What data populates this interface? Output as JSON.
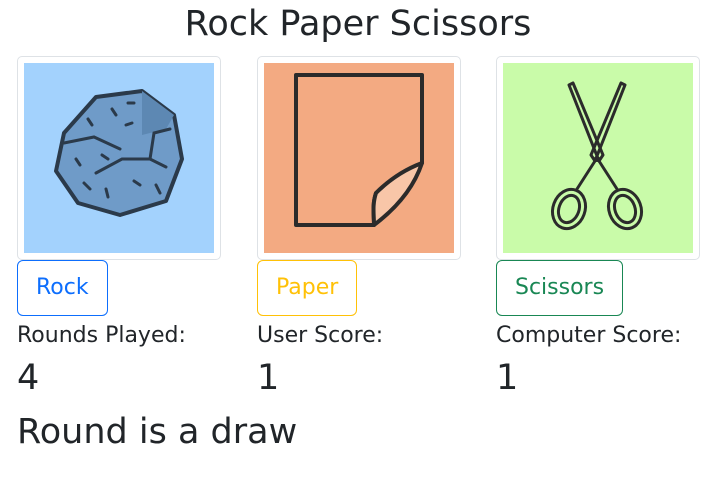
{
  "title": "Rock Paper Scissors",
  "choices": [
    {
      "key": "rock",
      "label": "Rock",
      "image_bg": "#a3d2fd",
      "button_color": "#0d6efd"
    },
    {
      "key": "paper",
      "label": "Paper",
      "image_bg": "#f3aa82",
      "button_color": "#ffc107"
    },
    {
      "key": "scissors",
      "label": "Scissors",
      "image_bg": "#c9fba9",
      "button_color": "#198754"
    }
  ],
  "stats": {
    "rounds_label": "Rounds Played:",
    "rounds_value": "4",
    "user_label": "User Score:",
    "user_value": "1",
    "computer_label": "Computer Score:",
    "computer_value": "1"
  },
  "result": "Round is a draw"
}
